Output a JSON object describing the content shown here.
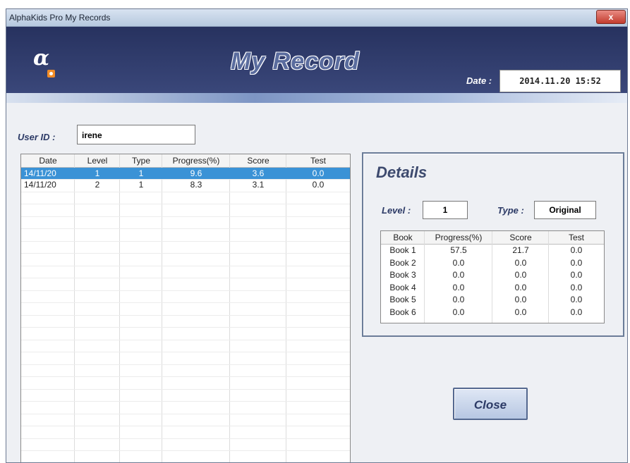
{
  "window": {
    "title": "AlphaKids Pro My Records",
    "close_label": "x"
  },
  "header": {
    "logo_text": "α",
    "title": "My Record",
    "date_label": "Date :",
    "date_value": "2014.11.20 15:52"
  },
  "user": {
    "label": "User ID :",
    "value": "irene"
  },
  "records": {
    "columns": [
      "Date",
      "Level",
      "Type",
      "Progress(%)",
      "Score",
      "Test"
    ],
    "rows": [
      [
        "14/11/20",
        "1",
        "1",
        "9.6",
        "3.6",
        "0.0"
      ],
      [
        "14/11/20",
        "2",
        "1",
        "8.3",
        "3.1",
        "0.0"
      ]
    ],
    "selected_row": 0
  },
  "details": {
    "title": "Details",
    "level_label": "Level :",
    "level_value": "1",
    "type_label": "Type :",
    "type_value": "Original",
    "columns": [
      "Book",
      "Progress(%)",
      "Score",
      "Test"
    ],
    "rows": [
      [
        "Book 1",
        "57.5",
        "21.7",
        "0.0"
      ],
      [
        "Book 2",
        "0.0",
        "0.0",
        "0.0"
      ],
      [
        "Book 3",
        "0.0",
        "0.0",
        "0.0"
      ],
      [
        "Book 4",
        "0.0",
        "0.0",
        "0.0"
      ],
      [
        "Book 5",
        "0.0",
        "0.0",
        "0.0"
      ],
      [
        "Book 6",
        "0.0",
        "0.0",
        "0.0"
      ]
    ]
  },
  "close_button": {
    "label": "Close"
  },
  "colors": {
    "banner": "#27325f",
    "selection": "#3a92d6",
    "accent_text": "#2c3a66"
  }
}
